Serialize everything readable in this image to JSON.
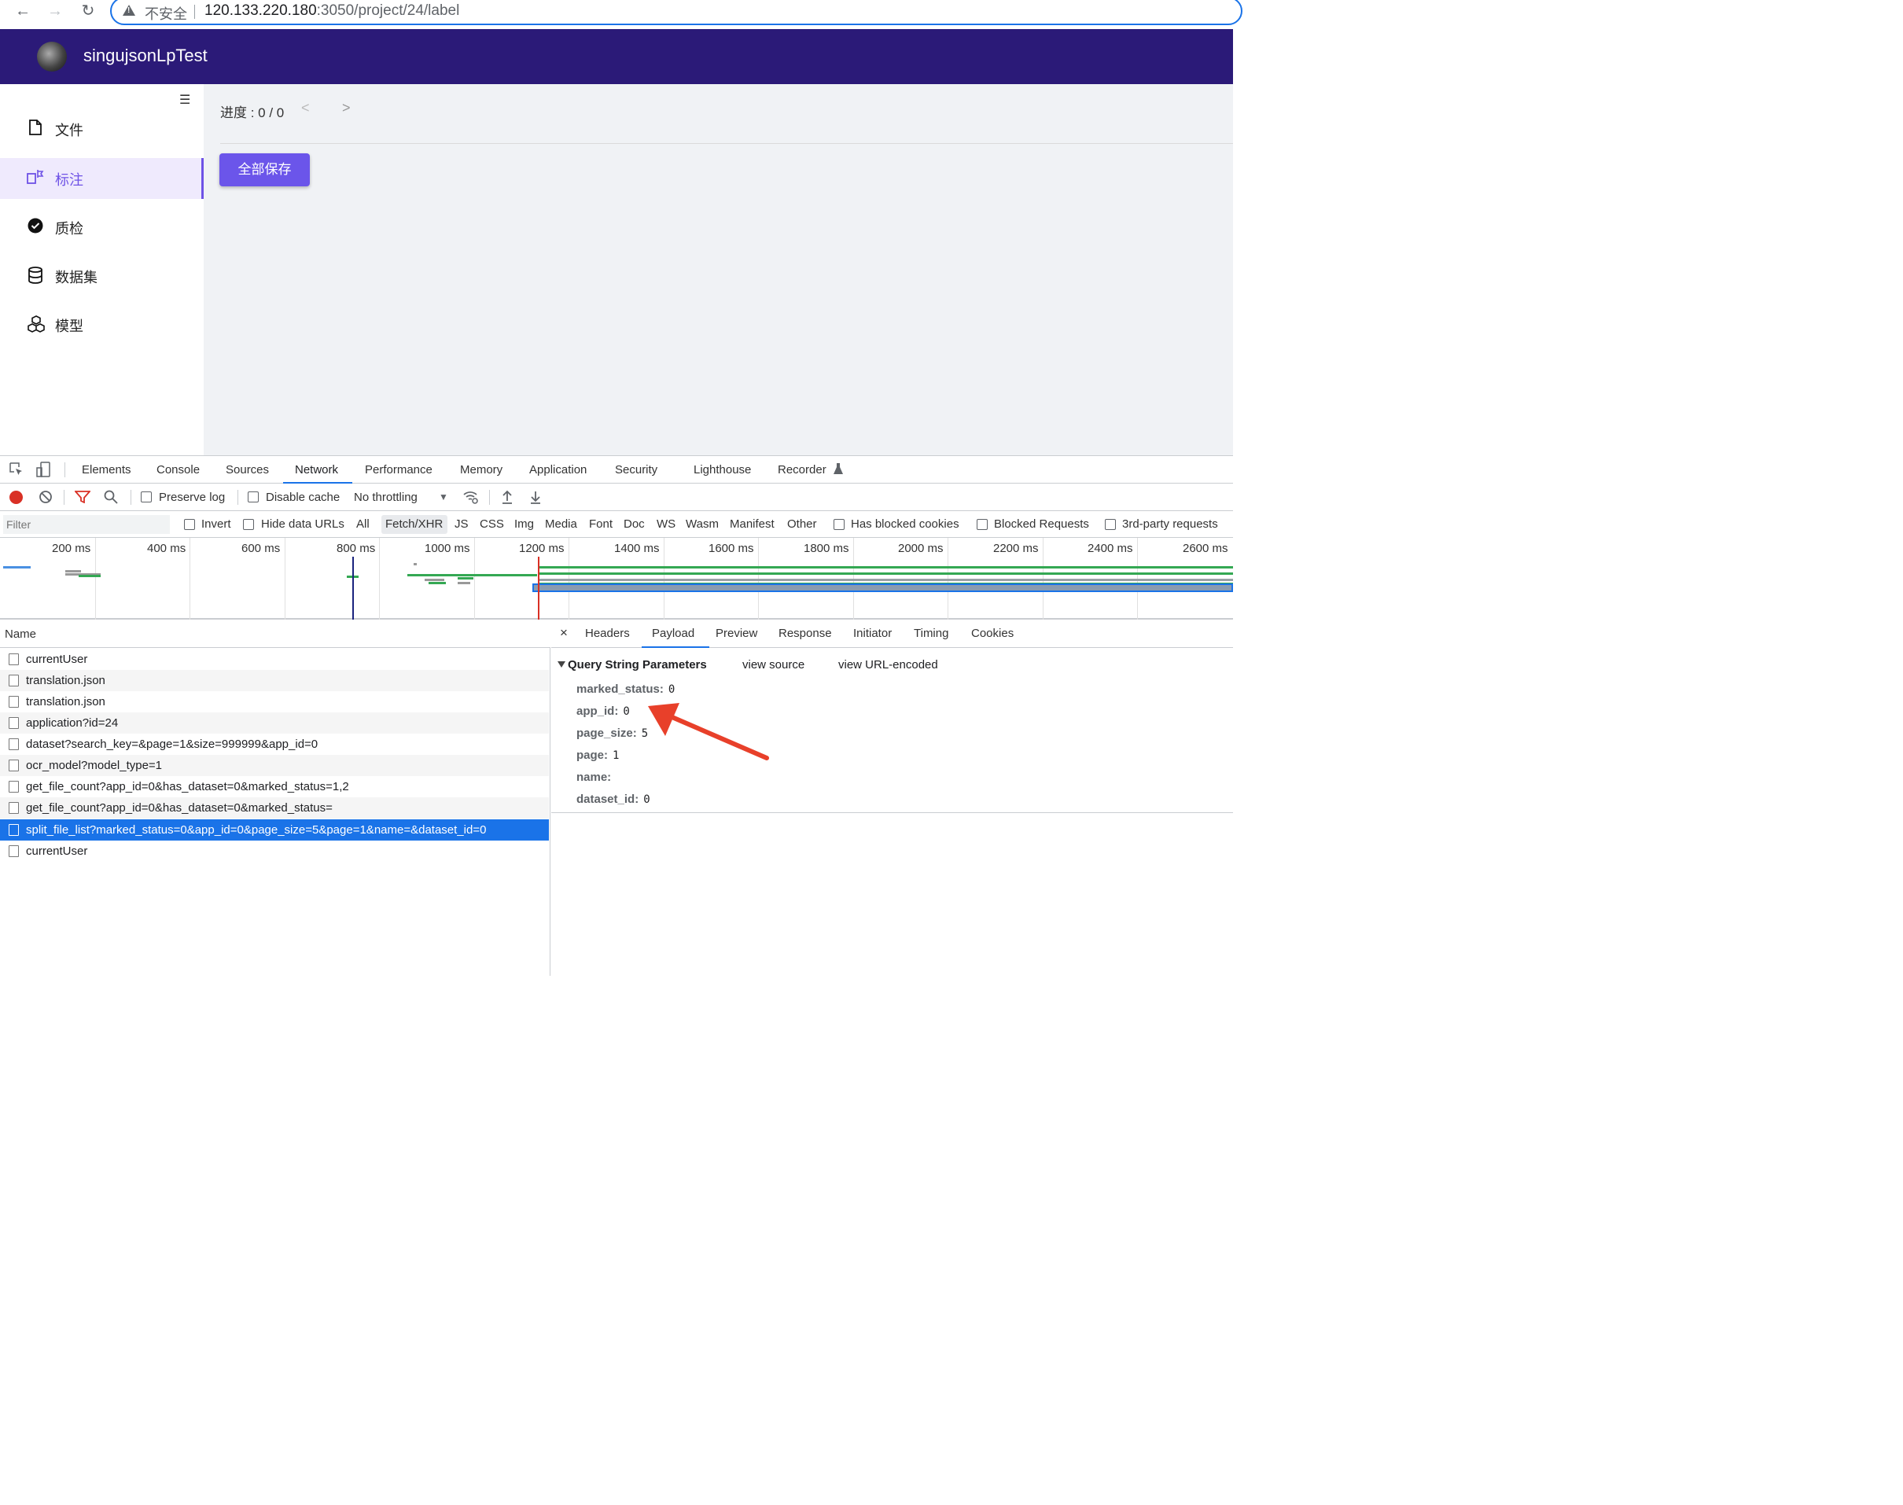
{
  "browser": {
    "security_label": "不安全",
    "url_host": "120.133.220.180",
    "url_rest": ":3050/project/24/label"
  },
  "app": {
    "title": "singujsonLpTest",
    "sidebar": {
      "items": [
        {
          "label": "文件",
          "icon": "file-icon"
        },
        {
          "label": "标注",
          "icon": "label-icon",
          "active": true
        },
        {
          "label": "质检",
          "icon": "check-circle-icon"
        },
        {
          "label": "数据集",
          "icon": "database-icon"
        },
        {
          "label": "模型",
          "icon": "cubes-icon"
        }
      ]
    },
    "content": {
      "progress_label": "进度 : 0 / 0",
      "prev": "<",
      "next": ">",
      "save_all": "全部保存"
    }
  },
  "devtools": {
    "tabs": [
      "Elements",
      "Console",
      "Sources",
      "Network",
      "Performance",
      "Memory",
      "Application",
      "Security",
      "Lighthouse",
      "Recorder"
    ],
    "active_tab": "Network",
    "toolbar": {
      "preserve_log": "Preserve log",
      "disable_cache": "Disable cache",
      "throttling": "No throttling"
    },
    "filterbar": {
      "filter_placeholder": "Filter",
      "invert": "Invert",
      "hide_data_urls": "Hide data URLs",
      "types": [
        "All",
        "Fetch/XHR",
        "JS",
        "CSS",
        "Img",
        "Media",
        "Font",
        "Doc",
        "WS",
        "Wasm",
        "Manifest",
        "Other"
      ],
      "has_blocked_cookies": "Has blocked cookies",
      "blocked_requests": "Blocked Requests",
      "third_party": "3rd-party requests"
    },
    "overview": {
      "ticks": [
        "200 ms",
        "400 ms",
        "600 ms",
        "800 ms",
        "1000 ms",
        "1200 ms",
        "1400 ms",
        "1600 ms",
        "1800 ms",
        "2000 ms",
        "2200 ms",
        "2400 ms",
        "2600 ms"
      ]
    },
    "requests": {
      "header": "Name",
      "rows": [
        "currentUser",
        "translation.json",
        "translation.json",
        "application?id=24",
        "dataset?search_key=&page=1&size=999999&app_id=0",
        "ocr_model?model_type=1",
        "get_file_count?app_id=0&has_dataset=0&marked_status=1,2",
        "get_file_count?app_id=0&has_dataset=0&marked_status=",
        "split_file_list?marked_status=0&app_id=0&page_size=5&page=1&name=&dataset_id=0",
        "currentUser"
      ],
      "selected_index": 8
    },
    "detail": {
      "close": "×",
      "tabs": [
        "Headers",
        "Payload",
        "Preview",
        "Response",
        "Initiator",
        "Timing",
        "Cookies"
      ],
      "active_tab": "Payload",
      "section_title": "Query String Parameters",
      "view_source": "view source",
      "view_url_encoded": "view URL-encoded",
      "params": [
        {
          "key": "marked_status:",
          "value": "0"
        },
        {
          "key": "app_id:",
          "value": "0"
        },
        {
          "key": "page_size:",
          "value": "5"
        },
        {
          "key": "page:",
          "value": "1"
        },
        {
          "key": "name:",
          "value": ""
        },
        {
          "key": "dataset_id:",
          "value": "0"
        }
      ]
    }
  }
}
